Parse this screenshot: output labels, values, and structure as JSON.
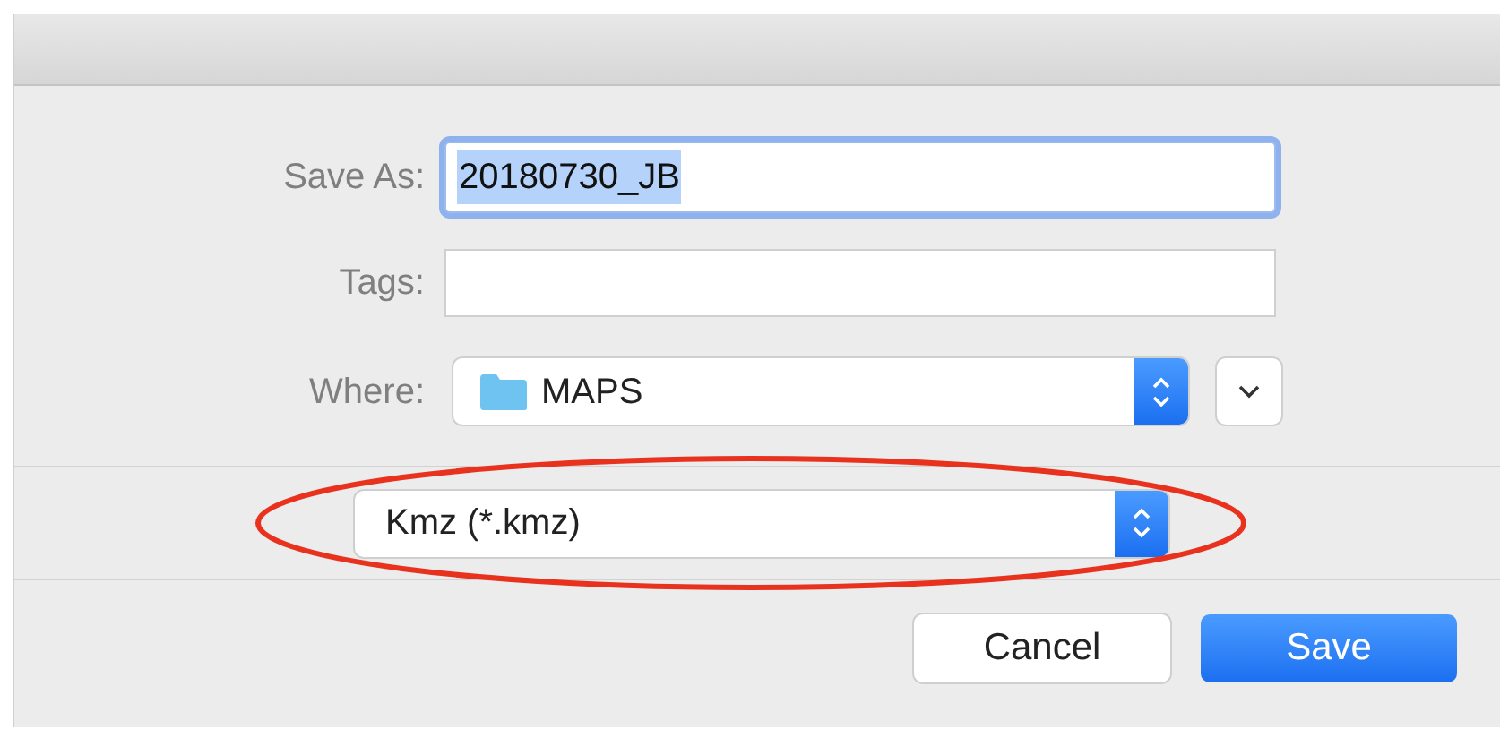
{
  "dialog": {
    "fields": [
      {
        "label": "Save As:",
        "kind": "text",
        "value": "20180730_JB",
        "focused": true
      },
      {
        "label": "Tags:",
        "kind": "text",
        "focused": false
      },
      {
        "label": "Where:",
        "kind": "popup",
        "value": "MAPS"
      }
    ],
    "format": {
      "value": "Kmz (*.kmz)"
    },
    "buttons": [
      {
        "label": "Cancel",
        "default": false
      },
      {
        "label": "Save",
        "default": true
      }
    ]
  },
  "annotation": {
    "kind": "ellipse"
  }
}
